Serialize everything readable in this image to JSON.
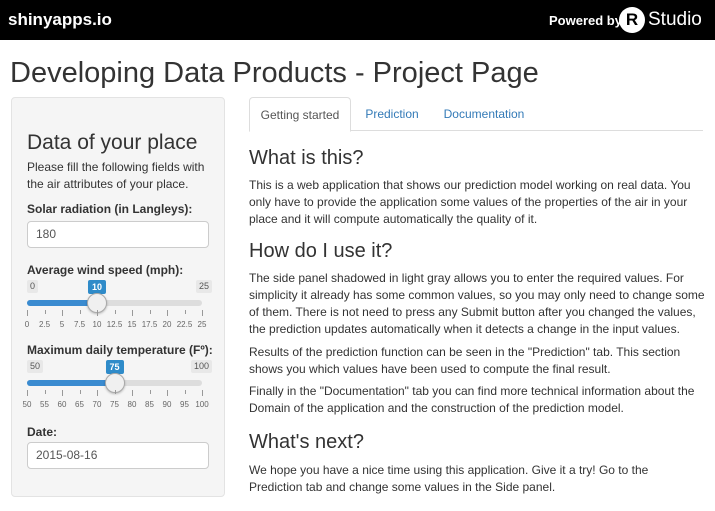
{
  "navbar": {
    "brand": "shinyapps.io",
    "powered_by": "Powered by",
    "rstudio_r": "R",
    "rstudio_word": "Studio"
  },
  "page": {
    "title": "Developing Data Products - Project Page"
  },
  "sidebar": {
    "heading": "Data of your place",
    "description": "Please fill the following fields with the air attributes of your place.",
    "solar": {
      "label": "Solar radiation (in Langleys):",
      "value": "180"
    },
    "wind": {
      "label": "Average wind speed (mph):",
      "min": "0",
      "max": "25",
      "value": "10",
      "ticks": [
        "0",
        "2.5",
        "5",
        "7.5",
        "10",
        "12.5",
        "15",
        "17.5",
        "20",
        "22.5",
        "25"
      ]
    },
    "temp": {
      "label": "Maximum daily temperature (Fº):",
      "min": "50",
      "max": "100",
      "value": "75",
      "ticks": [
        "50",
        "55",
        "60",
        "65",
        "70",
        "75",
        "80",
        "85",
        "90",
        "95",
        "100"
      ]
    },
    "date": {
      "label": "Date:",
      "value": "2015-08-16"
    }
  },
  "tabs": [
    {
      "label": "Getting started",
      "active": true
    },
    {
      "label": "Prediction",
      "active": false
    },
    {
      "label": "Documentation",
      "active": false
    }
  ],
  "content": {
    "what_title": "What is this?",
    "what_text": "This is a web application that shows our prediction model working on real data. You only have to provide the application some values of the properties of the air in your place and it will compute automatically the quality of it.",
    "how_title": "How do I use it?",
    "how_text_1": "The side panel shadowed in light gray allows you to enter the required values. For simplicity it already has some common values, so you may only need to change some of them. There is not need to press any Submit button after you changed the values, the prediction updates automatically when it detects a change in the input values.",
    "how_text_2": "Results of the prediction function can be seen in the \"Prediction\" tab. This section shows you which values have been used to compute the final result.",
    "how_text_3": "Finally in the \"Documentation\" tab you can find more technical information about the Domain of the application and the construction of the prediction model.",
    "next_title": "What's next?",
    "next_text": "We hope you have a nice time using this application. Give it a try! Go to the Prediction tab and change some values in the Side panel."
  },
  "colors": {
    "navbar_bg": "#000000",
    "slider_accent": "#2f8bc9",
    "link": "#337ab7",
    "panel_bg": "#f5f5f5"
  }
}
